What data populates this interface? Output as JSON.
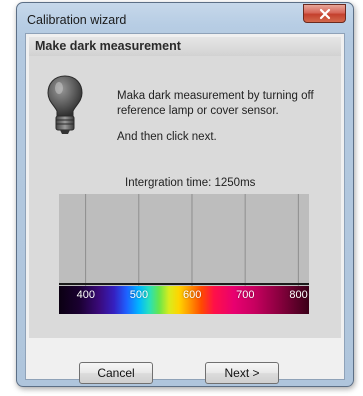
{
  "window": {
    "title": "Calibration wizard",
    "close_icon": "close-x-icon"
  },
  "section": {
    "title": "Make dark measurement"
  },
  "content": {
    "icon": "lightbulb-icon",
    "instruction": "Maka dark measurement by turning off reference lamp or cover sensor.",
    "instruction2": "And then click next.",
    "integration_label": "Intergration time:",
    "integration_value": "1250ms"
  },
  "chart_data": {
    "type": "line",
    "x": [
      350,
      400,
      450,
      500,
      550,
      600,
      650,
      700,
      750,
      800,
      820
    ],
    "series": [
      {
        "values": [
          0,
          0,
          0,
          0,
          0,
          0,
          0,
          0,
          0,
          0,
          0
        ]
      }
    ],
    "xlim": [
      350,
      820
    ],
    "xticks": [
      "400",
      "500",
      "600",
      "700",
      "800"
    ],
    "grid": true
  },
  "buttons": {
    "cancel": "Cancel",
    "next": "Next >"
  }
}
